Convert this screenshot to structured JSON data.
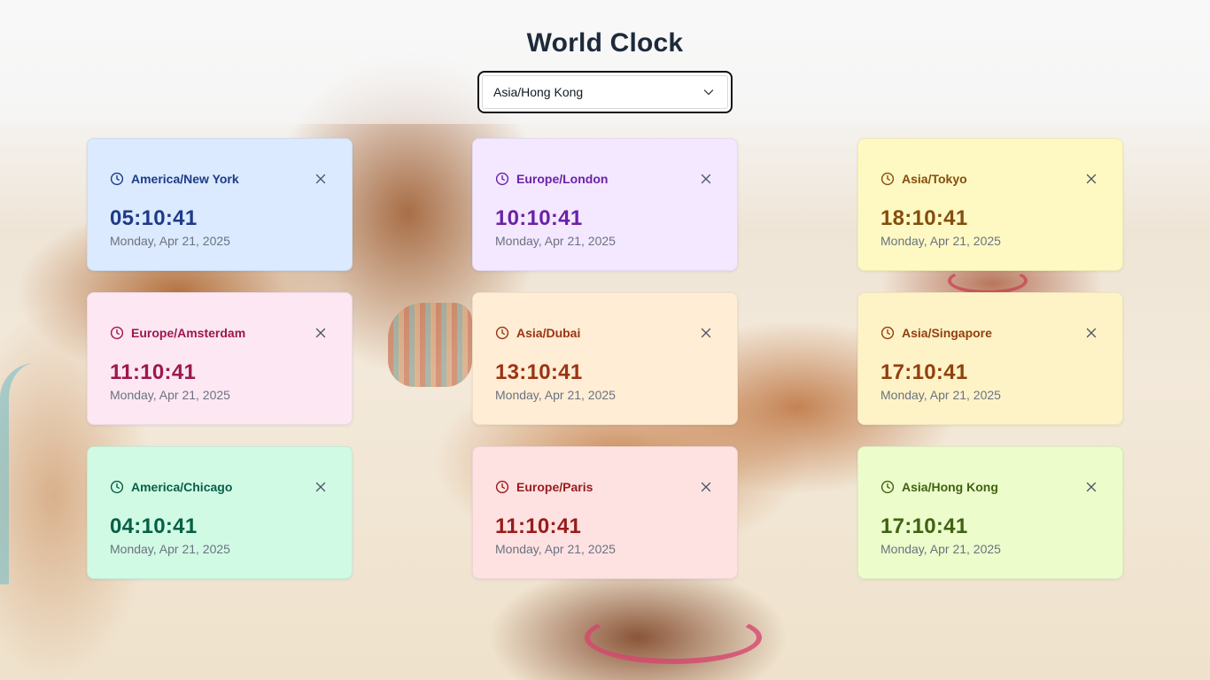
{
  "page": {
    "title": "World Clock"
  },
  "timezone_select": {
    "selected": "Asia/Hong Kong",
    "icon": "chevron-down-icon"
  },
  "clocks": [
    {
      "zone": "America/New York",
      "time": "05:10:41",
      "date": "Monday, Apr 21, 2025",
      "bg": "#dbeafe",
      "accent": "#1e3a8a"
    },
    {
      "zone": "Europe/London",
      "time": "10:10:41",
      "date": "Monday, Apr 21, 2025",
      "bg": "#f3e8ff",
      "accent": "#6b21a8"
    },
    {
      "zone": "Asia/Tokyo",
      "time": "18:10:41",
      "date": "Monday, Apr 21, 2025",
      "bg": "#fef9c3",
      "accent": "#854d0e"
    },
    {
      "zone": "Europe/Amsterdam",
      "time": "11:10:41",
      "date": "Monday, Apr 21, 2025",
      "bg": "#fce7f3",
      "accent": "#9d174d"
    },
    {
      "zone": "Asia/Dubai",
      "time": "13:10:41",
      "date": "Monday, Apr 21, 2025",
      "bg": "#ffedd5",
      "accent": "#9a3412"
    },
    {
      "zone": "Asia/Singapore",
      "time": "17:10:41",
      "date": "Monday, Apr 21, 2025",
      "bg": "#fef3c7",
      "accent": "#92400e"
    },
    {
      "zone": "America/Chicago",
      "time": "04:10:41",
      "date": "Monday, Apr 21, 2025",
      "bg": "#d1fae5",
      "accent": "#065f46"
    },
    {
      "zone": "Europe/Paris",
      "time": "11:10:41",
      "date": "Monday, Apr 21, 2025",
      "bg": "#fee2e2",
      "accent": "#991b1b"
    },
    {
      "zone": "Asia/Hong Kong",
      "time": "17:10:41",
      "date": "Monday, Apr 21, 2025",
      "bg": "#ecfccb",
      "accent": "#3f6212"
    }
  ],
  "icons": {
    "clock": "clock-icon",
    "remove": "close-icon"
  }
}
